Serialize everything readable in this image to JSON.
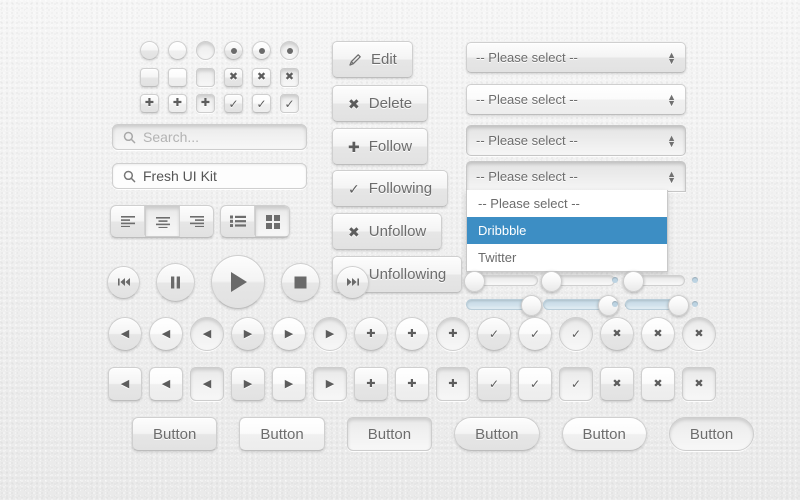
{
  "meta": {
    "title": "Fresh UI Kit",
    "accent_blue": "#3d8ec4",
    "slider_fill": "#c8dce8",
    "background": "#f1f1f1",
    "text_color": "#6d6d6d"
  },
  "controls": {
    "radios": [
      {
        "state": "normal",
        "checked": false
      },
      {
        "state": "hover",
        "checked": false
      },
      {
        "state": "pressed",
        "checked": false
      },
      {
        "state": "normal",
        "checked": true
      },
      {
        "state": "hover",
        "checked": true
      },
      {
        "state": "pressed",
        "checked": true
      }
    ],
    "checkboxes_x": [
      {
        "state": "normal",
        "glyph": ""
      },
      {
        "state": "hover",
        "glyph": ""
      },
      {
        "state": "pressed",
        "glyph": ""
      },
      {
        "state": "normal",
        "glyph": "✖"
      },
      {
        "state": "hover",
        "glyph": "✖"
      },
      {
        "state": "pressed",
        "glyph": "✖"
      }
    ],
    "checkboxes_plus_check": [
      {
        "state": "normal",
        "glyph": "✚"
      },
      {
        "state": "hover",
        "glyph": "✚"
      },
      {
        "state": "pressed",
        "glyph": "✚"
      },
      {
        "state": "normal",
        "glyph": "✓"
      },
      {
        "state": "hover",
        "glyph": "✓"
      },
      {
        "state": "pressed",
        "glyph": "✓"
      }
    ]
  },
  "search": {
    "placeholder": "Search...",
    "filled_value": "Fresh UI Kit",
    "icon": "search-icon"
  },
  "segmented": {
    "align": [
      {
        "name": "align-left",
        "label": "Align left"
      },
      {
        "name": "align-center",
        "label": "Align center"
      },
      {
        "name": "align-right",
        "label": "Align right"
      }
    ],
    "view": [
      {
        "name": "list-view",
        "label": "List view"
      },
      {
        "name": "grid-view",
        "label": "Grid view"
      }
    ]
  },
  "action_buttons": [
    {
      "label": "Edit",
      "icon": "pencil-icon"
    },
    {
      "label": "Delete",
      "icon": "cross-icon"
    },
    {
      "label": "Follow",
      "icon": "plus-icon"
    },
    {
      "label": "Following",
      "icon": "check-icon"
    },
    {
      "label": "Unfollow",
      "icon": "cross-icon"
    },
    {
      "label": "Unfollowing",
      "icon": "check-icon"
    }
  ],
  "selects": {
    "placeholder": "-- Please select --",
    "items": [
      {
        "value": "-- Please select --",
        "state": "normal"
      },
      {
        "value": "-- Please select --",
        "state": "normal"
      },
      {
        "value": "-- Please select --",
        "state": "hover"
      },
      {
        "value": "-- Please select --",
        "state": "open"
      }
    ],
    "open_options": [
      {
        "label": "-- Please select --",
        "highlighted": false
      },
      {
        "label": "Dribbble",
        "highlighted": true
      },
      {
        "label": "Twitter",
        "highlighted": false
      }
    ]
  },
  "media_player": [
    {
      "name": "previous-button",
      "icon": "skip-back-icon",
      "size": "small"
    },
    {
      "name": "pause-button",
      "icon": "pause-icon",
      "size": "medium"
    },
    {
      "name": "play-button",
      "icon": "play-icon",
      "size": "large"
    },
    {
      "name": "stop-button",
      "icon": "stop-icon",
      "size": "medium"
    },
    {
      "name": "next-button",
      "icon": "skip-forward-icon",
      "size": "small"
    }
  ],
  "icon_buttons": {
    "groups": [
      {
        "icon": "arrow-left-icon",
        "glyph": "◀",
        "states": [
          "normal",
          "hover",
          "pressed"
        ]
      },
      {
        "icon": "arrow-right-icon",
        "glyph": "▶",
        "states": [
          "normal",
          "hover",
          "pressed"
        ]
      },
      {
        "icon": "plus-icon",
        "glyph": "✚",
        "states": [
          "normal",
          "hover",
          "pressed"
        ]
      },
      {
        "icon": "check-icon",
        "glyph": "✓",
        "states": [
          "normal",
          "hover",
          "pressed"
        ]
      },
      {
        "icon": "cross-icon",
        "glyph": "✖",
        "states": [
          "normal",
          "hover",
          "pressed"
        ]
      }
    ],
    "shapes": [
      "round",
      "square"
    ]
  },
  "sliders": [
    {
      "name": "slider-empty-left",
      "position": "left",
      "filled": false,
      "marker": ""
    },
    {
      "name": "slider-filled-left",
      "position": "right",
      "filled": true,
      "marker": ""
    },
    {
      "name": "slider-x-empty",
      "position": "left",
      "filled": false,
      "marker": "✖"
    },
    {
      "name": "slider-check-filled",
      "position": "right",
      "filled": true,
      "marker": "✓"
    },
    {
      "name": "slider-dotted-empty",
      "position": "left",
      "filled": false,
      "marker": "dots"
    },
    {
      "name": "slider-dotted-filled",
      "position": "right",
      "filled": true,
      "marker": "dots"
    }
  ],
  "bottom_buttons": [
    {
      "label": "Button",
      "shape": "rect",
      "state": "normal"
    },
    {
      "label": "Button",
      "shape": "rect",
      "state": "hover"
    },
    {
      "label": "Button",
      "shape": "rect",
      "state": "pressed"
    },
    {
      "label": "Button",
      "shape": "pill",
      "state": "normal"
    },
    {
      "label": "Button",
      "shape": "pill",
      "state": "hover"
    },
    {
      "label": "Button",
      "shape": "pill",
      "state": "pressed"
    }
  ]
}
